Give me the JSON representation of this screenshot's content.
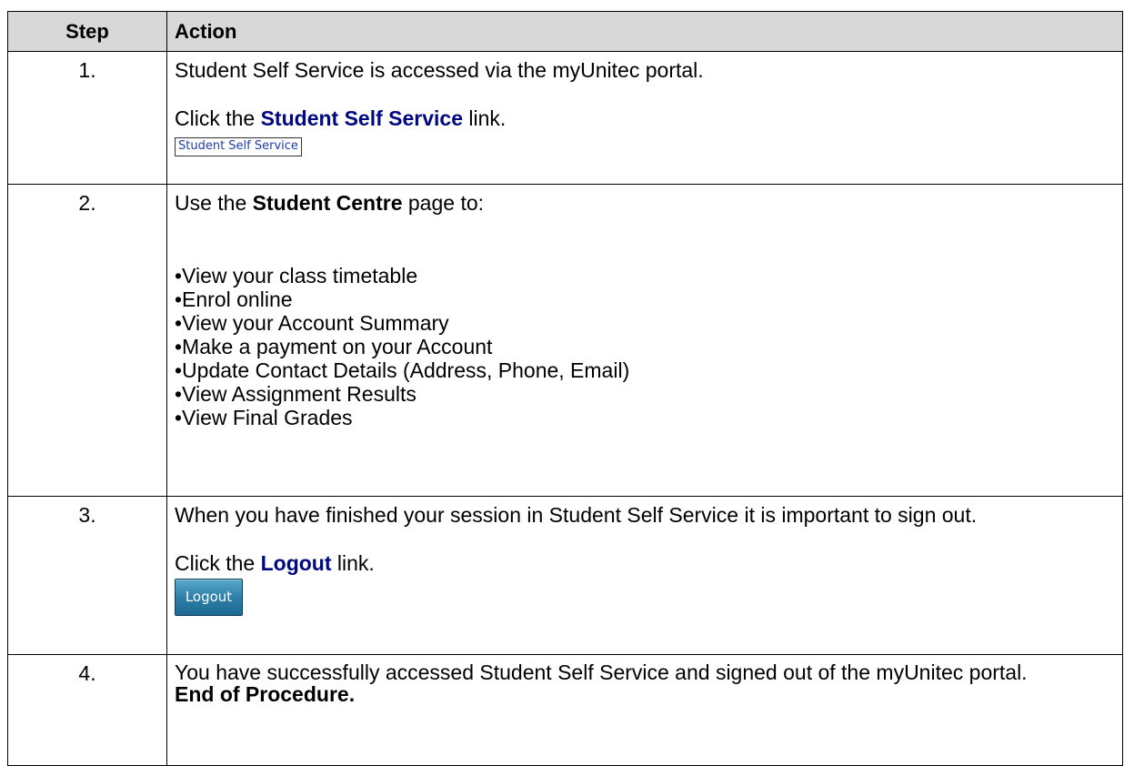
{
  "header": {
    "step": "Step",
    "action": "Action"
  },
  "rows": [
    {
      "step": "1.",
      "line1": "Student Self Service is accessed via the myUnitec portal.",
      "instruction_pre": "Click the ",
      "instruction_link": "Student Self Service",
      "instruction_post": " link.",
      "link_image_text": "Student Self Service"
    },
    {
      "step": "2.",
      "intro_pre": "Use the ",
      "intro_bold": "Student Centre",
      "intro_post": " page to:",
      "bullets": [
        "•View your class timetable",
        "•Enrol online",
        "•View your Account Summary",
        "•Make a payment on your Account",
        "•Update Contact Details (Address, Phone, Email)",
        "•View Assignment Results",
        "•View Final Grades"
      ]
    },
    {
      "step": "3.",
      "line1": "When you have finished your session in Student Self Service it is important to sign out.",
      "instruction_pre": "Click the ",
      "instruction_link": "Logout",
      "instruction_post": " link.",
      "button_text": "Logout"
    },
    {
      "step": "4.",
      "line1": "You have successfully accessed Student Self Service and signed out of the myUnitec portal.",
      "end_text": "End of Procedure."
    }
  ],
  "colors": {
    "header_bg": "#d8d8d8",
    "link_text": "#00087f",
    "button_bg": "#2e7fa8"
  }
}
